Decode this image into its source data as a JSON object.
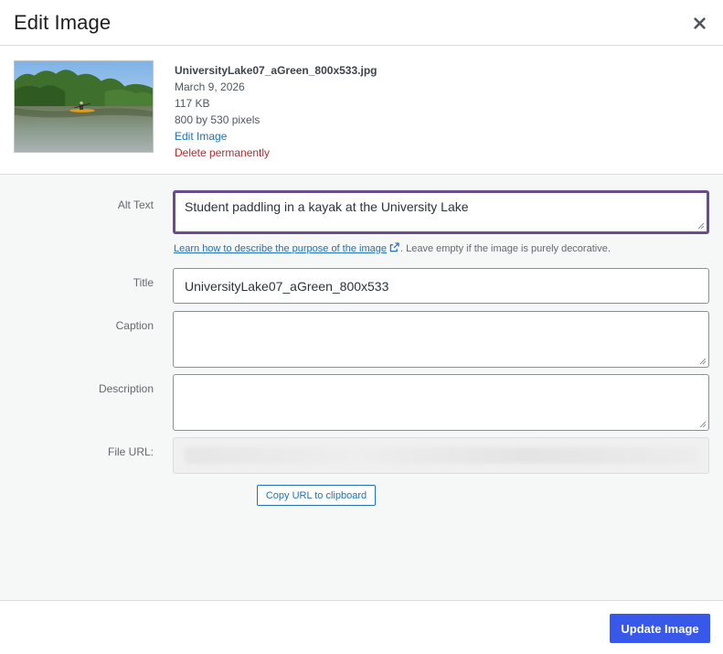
{
  "header": {
    "title": "Edit Image"
  },
  "icons": {
    "close": "close-icon",
    "external": "external-link-icon",
    "resize": "resize-handle-icon"
  },
  "attachment": {
    "filename": "UniversityLake07_aGreen_800x533.jpg",
    "date": "March 9, 2026",
    "filesize": "117 KB",
    "dimensions": "800 by 530 pixels",
    "edit_label": "Edit Image",
    "delete_label": "Delete permanently"
  },
  "form": {
    "alt_text": {
      "label": "Alt Text",
      "value": "Student paddling in a kayak at the University Lake",
      "help_link": "Learn how to describe the purpose of the image",
      "help_text": ". Leave empty if the image is purely decorative."
    },
    "title": {
      "label": "Title",
      "value": "UniversityLake07_aGreen_800x533"
    },
    "caption": {
      "label": "Caption",
      "value": ""
    },
    "description": {
      "label": "Description",
      "value": ""
    },
    "file_url": {
      "label": "File URL:",
      "value": ""
    },
    "copy_label": "Copy URL to clipboard"
  },
  "footer": {
    "update_label": "Update Image"
  },
  "colors": {
    "primary": "#3858e9",
    "link": "#2271b1",
    "danger": "#b32d2e",
    "focus": "#6a4b8e",
    "panel": "#f6f7f7"
  }
}
